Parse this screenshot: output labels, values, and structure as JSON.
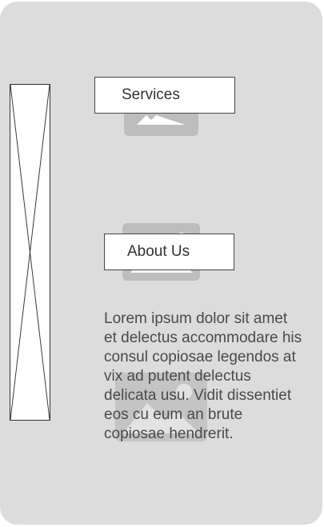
{
  "sections": {
    "services_label": "Services",
    "about_label": "About Us"
  },
  "content": {
    "paragraph": "Lorem ipsum dolor sit amet et delectus accommodare his consul copiosae legendos at vix ad putent delectus delicata usu. Vidit dissentiet eos cu eum an brute copiosae hendrerit."
  },
  "colors": {
    "panel_background": "#dcdcdc",
    "image_icon": "#bdbdbd",
    "box_border": "#444444",
    "text": "#4a4a4a"
  },
  "icons": {
    "image_placeholder": "image-icon",
    "crossed_placeholder": "crossed-box-placeholder"
  }
}
